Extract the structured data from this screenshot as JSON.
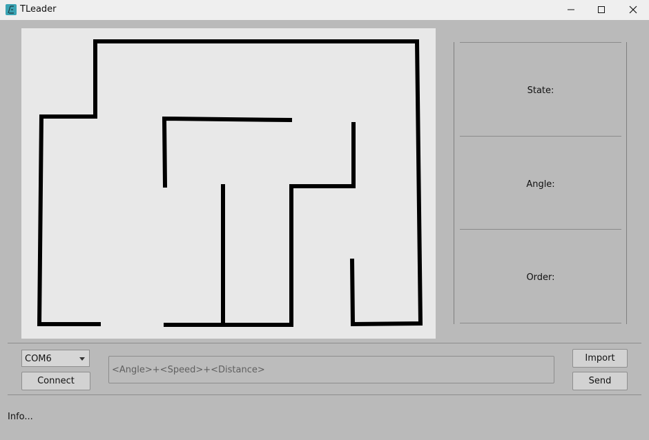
{
  "window": {
    "title": "TLeader"
  },
  "title_icons": {
    "app": "tleader-app-icon",
    "minimize": "minimize-icon",
    "maximize": "maximize-icon",
    "close": "close-icon"
  },
  "maze": {
    "wall_color": "#000000",
    "background": "#e8e8e8"
  },
  "info_panel": {
    "state_label": "State:",
    "angle_label": "Angle:",
    "order_label": "Order:"
  },
  "controls": {
    "port_select": "COM6",
    "connect_label": "Connect",
    "command_placeholder": "<Angle>+<Speed>+<Distance>",
    "import_label": "Import",
    "send_label": "Send"
  },
  "status": {
    "text": "Info..."
  }
}
